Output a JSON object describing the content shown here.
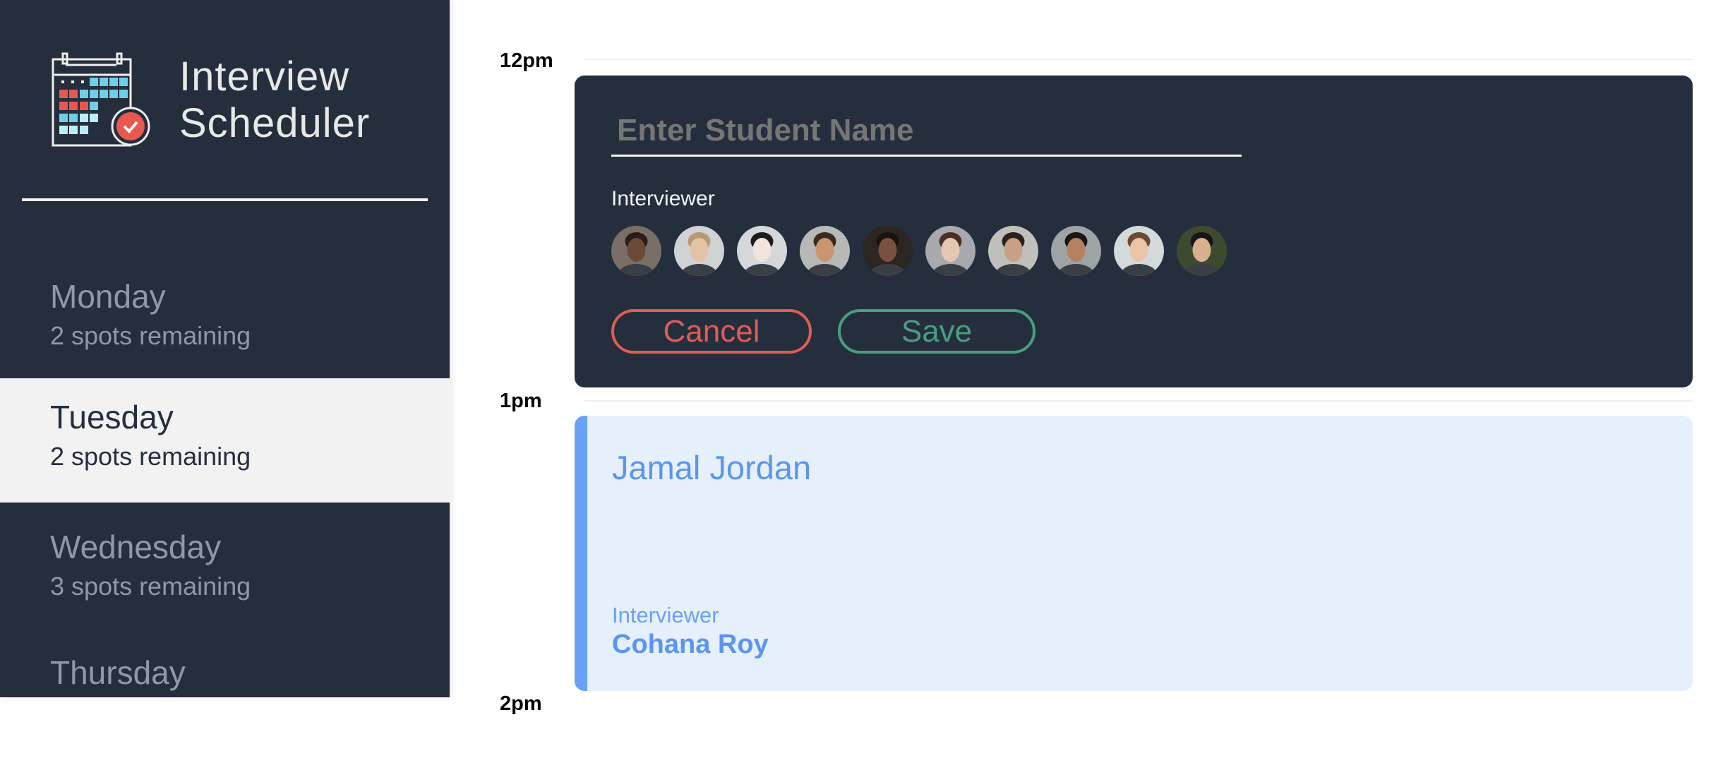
{
  "app": {
    "title_line1": "Interview",
    "title_line2": "Scheduler"
  },
  "sidebar": {
    "days": [
      {
        "name": "Monday",
        "spots": "2 spots remaining",
        "selected": false
      },
      {
        "name": "Tuesday",
        "spots": "2 spots remaining",
        "selected": true
      },
      {
        "name": "Wednesday",
        "spots": "3 spots remaining",
        "selected": false
      },
      {
        "name": "Thursday",
        "spots": "",
        "selected": false
      }
    ]
  },
  "schedule": {
    "times": [
      "12pm",
      "1pm",
      "2pm"
    ],
    "form": {
      "student_placeholder": "Enter Student Name",
      "student_value": "",
      "interviewer_label": "Interviewer",
      "interviewers": [
        {
          "bg": "#7a6e68",
          "skin": "#6b4a3a",
          "hair": "#2a1d17"
        },
        {
          "bg": "#cfd3d4",
          "skin": "#e3c2a8",
          "hair": "#b89a70"
        },
        {
          "bg": "#d5d7da",
          "skin": "#f0e4dc",
          "hair": "#1c1c1c"
        },
        {
          "bg": "#b7b9b6",
          "skin": "#c8956e",
          "hair": "#3a2a20"
        },
        {
          "bg": "#2c2622",
          "skin": "#7a5040",
          "hair": "#1a1410"
        },
        {
          "bg": "#a8a9ae",
          "skin": "#e6c6b4",
          "hair": "#4a3024"
        },
        {
          "bg": "#bfc0bb",
          "skin": "#c9a084",
          "hair": "#2a2220"
        },
        {
          "bg": "#9ea3a6",
          "skin": "#b48262",
          "hair": "#1a1512"
        },
        {
          "bg": "#d4d9dc",
          "skin": "#e8c4a8",
          "hair": "#6a4a30"
        },
        {
          "bg": "#3e4a30",
          "skin": "#d8b090",
          "hair": "#151515"
        }
      ],
      "cancel_label": "Cancel",
      "save_label": "Save",
      "colors": {
        "cancel": "#e05c55",
        "save": "#4a9e7f"
      }
    },
    "appointment": {
      "student": "Jamal Jordan",
      "interviewer_label": "Interviewer",
      "interviewer": "Cohana Roy",
      "accent": "#6aa0f7"
    }
  }
}
